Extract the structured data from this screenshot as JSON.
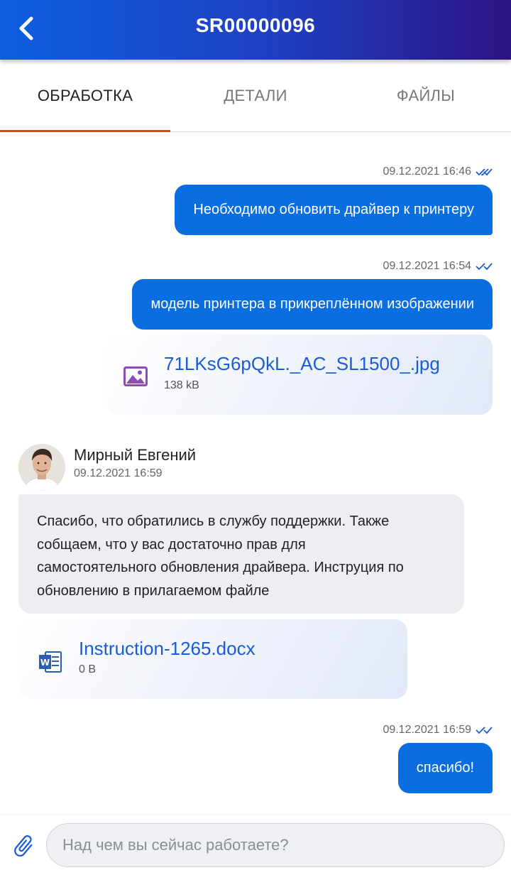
{
  "header": {
    "title": "SR00000096"
  },
  "tabs": [
    {
      "label": "ОБРАБОТКА",
      "active": true
    },
    {
      "label": "ДЕТАЛИ",
      "active": false
    },
    {
      "label": "ФАЙЛЫ",
      "active": false
    }
  ],
  "messages": [
    {
      "direction": "outgoing",
      "time": "09.12.2021 16:46",
      "text": "Необходимо обновить драйвер к принтеру",
      "status": "double-check-icon"
    },
    {
      "direction": "outgoing",
      "time": "09.12.2021 16:54",
      "text": "модель принтера в прикреплённом изображении",
      "status": "double-check-icon",
      "attachment": {
        "name": "71LKsG6pQkL._AC_SL1500_.jpg",
        "size": "138 kB",
        "icon": "image-file-icon"
      }
    },
    {
      "direction": "incoming",
      "sender": "Мирный Евгений",
      "time": "09.12.2021 16:59",
      "lines": [
        "Спасибо, что обратились  в службу поддержки. Также",
        "собщаем, что у вас достаточно прав для",
        "самостоятельного обновления драйвера. Инструция по",
        "обновлению в прилагаемом файле"
      ],
      "attachment": {
        "name": "Instruction-1265.docx",
        "size": "0 B",
        "icon": "word-file-icon"
      }
    },
    {
      "direction": "outgoing",
      "time": "09.12.2021 16:59",
      "text": "спасибо!",
      "status": "double-check-icon"
    }
  ],
  "composer": {
    "placeholder": "Над чем вы сейчас работаете?"
  },
  "colors": {
    "accent": "#0b6ee0",
    "tab_indicator": "#e53b1a",
    "link": "#1a5cd6"
  }
}
